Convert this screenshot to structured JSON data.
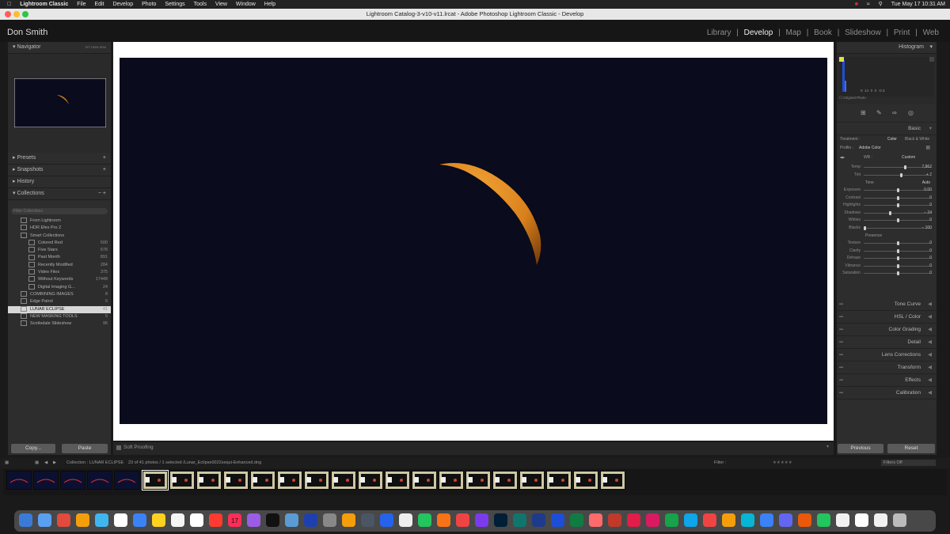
{
  "menubar": {
    "items": [
      "Lightroom Classic",
      "File",
      "Edit",
      "Develop",
      "Photo",
      "Settings",
      "Tools",
      "View",
      "Window",
      "Help"
    ],
    "datetime": "Tue May 17  10:31 AM"
  },
  "window": {
    "title": "Lightroom Catalog-3-v10-v11.lrcat - Adobe Photoshop Lightroom Classic - Develop"
  },
  "identity_plate": "Don Smith",
  "modules": [
    {
      "label": "Library",
      "active": false
    },
    {
      "label": "Develop",
      "active": true
    },
    {
      "label": "Map",
      "active": false
    },
    {
      "label": "Book",
      "active": false
    },
    {
      "label": "Slideshow",
      "active": false
    },
    {
      "label": "Print",
      "active": false
    },
    {
      "label": "Web",
      "active": false
    }
  ],
  "left_panel": {
    "navigator": {
      "title": "Navigator",
      "zoom_options": [
        "FIT",
        "100%",
        "50%"
      ]
    },
    "presets": "Presets",
    "snapshots": "Snapshots",
    "history": "History",
    "collections": {
      "title": "Collections",
      "search_placeholder": "Filter Collections",
      "items": [
        {
          "label": "From Lightroom",
          "count": "",
          "indent": 1
        },
        {
          "label": "HDR Efex Pro 2",
          "count": "",
          "indent": 1
        },
        {
          "label": "Smart Collections",
          "count": "",
          "indent": 1
        },
        {
          "label": "Colored Red",
          "count": "500",
          "indent": 2
        },
        {
          "label": "Five Stars",
          "count": "678",
          "indent": 2
        },
        {
          "label": "Past Month",
          "count": "891",
          "indent": 2
        },
        {
          "label": "Recently Modified",
          "count": "284",
          "indent": 2
        },
        {
          "label": "Video Files",
          "count": "375",
          "indent": 2
        },
        {
          "label": "Without Keywords",
          "count": "17448",
          "indent": 2
        },
        {
          "label": "Digital Imaging G...",
          "count": "24",
          "indent": 2
        },
        {
          "label": "COMBINING IMAGES",
          "count": "8",
          "indent": 1
        },
        {
          "label": "Edge Patrol",
          "count": "5",
          "indent": 1
        },
        {
          "label": "LUNAR ECLIPSE",
          "count": "41",
          "indent": 1,
          "selected": true
        },
        {
          "label": "NEW MASKING TOOLS",
          "count": "5",
          "indent": 1
        },
        {
          "label": "Scottsdale Slideshow",
          "count": "96",
          "indent": 1
        }
      ]
    },
    "copy_button": "Copy...",
    "paste_button": "Paste"
  },
  "center": {
    "soft_proofing": "Soft Proofing"
  },
  "right_panel": {
    "histogram": {
      "title": "Histogram",
      "readout": [
        "0",
        "14",
        "0",
        "0",
        "-0.3"
      ],
      "original_photo": "Original Photo"
    },
    "basic": {
      "title": "Basic",
      "treatment_label": "Treatment :",
      "treatment_color": "Color",
      "treatment_bw": "Black & White",
      "profile_label": "Profile :",
      "profile_value": "Adobe Color",
      "wb_label": "WB :",
      "wb_value": "Custom",
      "tone_label": "Tone",
      "tone_auto": "Auto",
      "presence_label": "Presence",
      "sliders_wb": [
        {
          "label": "Temp",
          "value": "7,862",
          "pos": 0.62
        },
        {
          "label": "Tint",
          "value": "+ 7",
          "pos": 0.55
        }
      ],
      "sliders_tone": [
        {
          "label": "Exposure",
          "value": "0.00",
          "pos": 0.5
        },
        {
          "label": "Contrast",
          "value": "0",
          "pos": 0.5
        },
        {
          "label": "Highlights",
          "value": "0",
          "pos": 0.5
        },
        {
          "label": "Shadows",
          "value": "− 24",
          "pos": 0.38
        },
        {
          "label": "Whites",
          "value": "0",
          "pos": 0.5
        },
        {
          "label": "Blacks",
          "value": "− 100",
          "pos": 0.0
        }
      ],
      "sliders_presence": [
        {
          "label": "Texture",
          "value": "0",
          "pos": 0.5
        },
        {
          "label": "Clarity",
          "value": "0",
          "pos": 0.5
        },
        {
          "label": "Dehaze",
          "value": "0",
          "pos": 0.5
        },
        {
          "label": "Vibrance",
          "value": "0",
          "pos": 0.5
        },
        {
          "label": "Saturation",
          "value": "0",
          "pos": 0.5
        }
      ]
    },
    "sections": [
      "Tone Curve",
      "HSL / Color",
      "Color Grading",
      "Detail",
      "Lens Corrections",
      "Transform",
      "Effects",
      "Calibration"
    ],
    "previous_button": "Previous",
    "reset_button": "Reset"
  },
  "filmstrip": {
    "source": "Collection : LUNAR ECLIPSE",
    "info": "23 of 41 photos / 1 selected /Lunar_Eclipse0022sequi-Enhanced.dng",
    "filter_label": "Filter :",
    "filter_value": "Filters Off"
  },
  "dock": {
    "calendar_day": "17"
  },
  "colors": {
    "moon": "#e08a1e",
    "sky": "#0a0b1c",
    "accent": "#cfcfcf"
  }
}
